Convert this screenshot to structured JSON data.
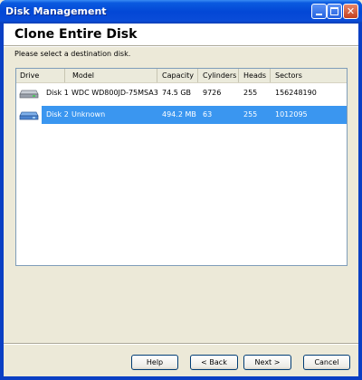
{
  "window": {
    "title": "Disk Management"
  },
  "header": {
    "title": "Clone Entire Disk"
  },
  "prompt": "Please select a destination disk.",
  "table": {
    "columns": [
      "Drive",
      "Model",
      "Capacity",
      "Cylinders",
      "Heads",
      "Sectors"
    ],
    "rows": [
      {
        "drive": "Disk 1",
        "model": "WDC WD800JD-75MSA3",
        "capacity": "74.5 GB",
        "cylinders": "9726",
        "heads": "255",
        "sectors": "156248190",
        "selected": false
      },
      {
        "drive": "Disk 2",
        "model": "Unknown",
        "capacity": "494.2 MB",
        "cylinders": "63",
        "heads": "255",
        "sectors": "1012095",
        "selected": true
      }
    ]
  },
  "buttons": {
    "help": "Help",
    "back": "< Back",
    "next": "Next >",
    "cancel": "Cancel"
  },
  "colors": {
    "selection": "#3a96f0",
    "titlebar": "#0a5ae0"
  },
  "icons": {
    "disk": "hard-disk-icon",
    "minimize": "minimize-icon",
    "maximize": "maximize-icon",
    "close": "close-icon"
  }
}
